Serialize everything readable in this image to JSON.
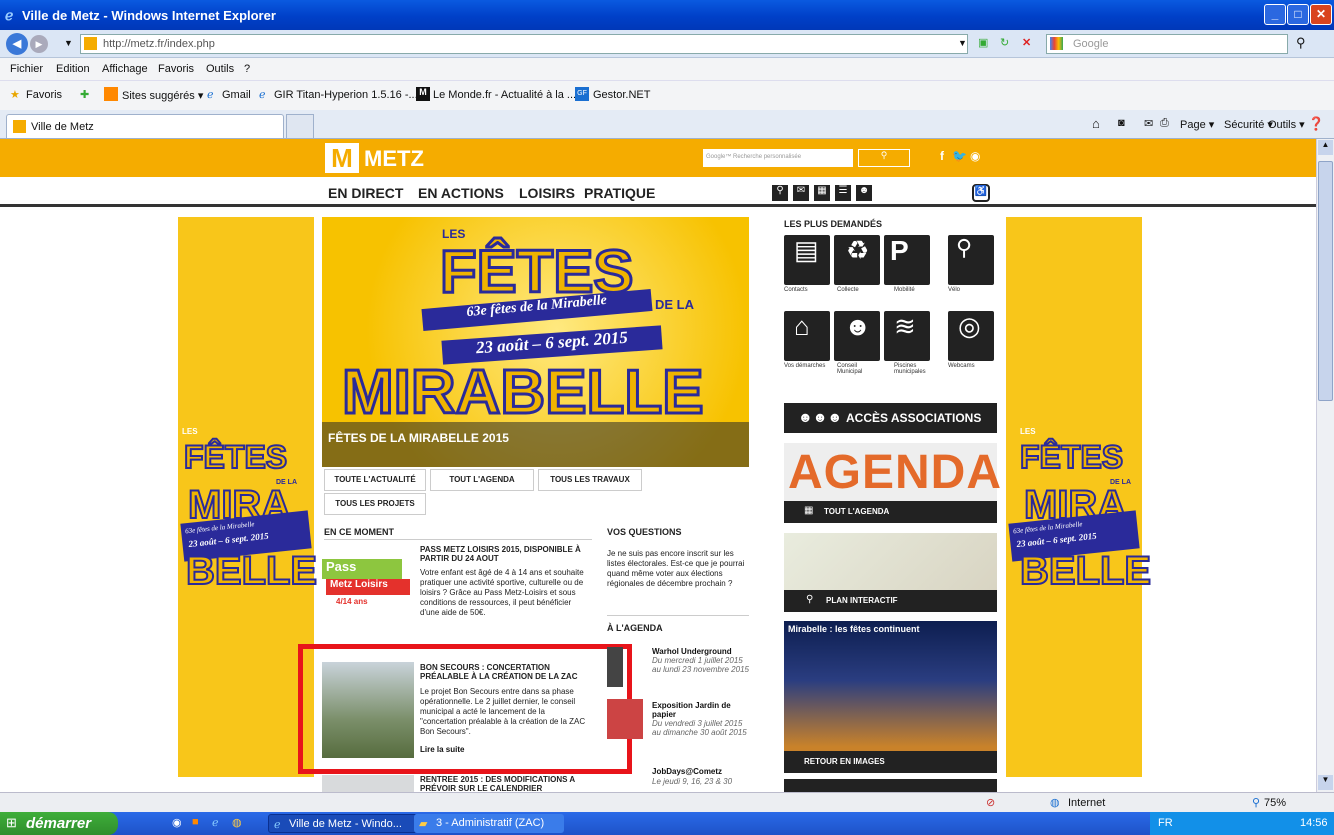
{
  "window": {
    "title": "Ville de Metz - Windows Internet Explorer"
  },
  "toolbar": {
    "url": "http://metz.fr/index.php",
    "search_placeholder": "Google"
  },
  "menu": [
    "Fichier",
    "Edition",
    "Affichage",
    "Favoris",
    "Outils",
    "?"
  ],
  "favorites": {
    "label": "Favoris",
    "items": [
      "Sites suggérés ▾",
      "Gmail",
      "GIR Titan-Hyperion 1.5.16 -...",
      "Le Monde.fr - Actualité à la ...",
      "Gestor.NET"
    ]
  },
  "tab": {
    "label": "Ville de Metz"
  },
  "cmdbar": [
    "Page ▾",
    "Sécurité ▾",
    "Outils ▾"
  ],
  "site": {
    "logo": "METZ",
    "search_placeholder": "Google™ Recherche personnalisée",
    "nav": [
      "EN DIRECT",
      "EN ACTIONS",
      "LOISIRS",
      "PRATIQUE"
    ],
    "hero": {
      "caption": "FÊTES DE LA MIRABELLE 2015",
      "big1": "FÊTES",
      "big2": "MIRABELLE",
      "les": "LES",
      "dela": "DE LA",
      "subtitle": "63e fêtes de la Mirabelle",
      "dates": "23 août – 6 sept. 2015"
    },
    "tabs": [
      "TOUTE L'ACTUALITÉ",
      "TOUT L'AGENDA",
      "TOUS LES TRAVAUX",
      "TOUS LES PROJETS"
    ],
    "en_ce_moment": "EN CE MOMENT",
    "news": [
      {
        "title": "PASS METZ LOISIRS 2015, DISPONIBLE À PARTIR DU 24 AOUT",
        "body": "Votre enfant est âgé de 4 à 14 ans et souhaite pratiquer une activité sportive, culturelle ou de loisirs ? Grâce au Pass Metz-Loisirs et sous conditions de ressources, il peut bénéficier d'une aide de 50€.",
        "img_a": "Pass",
        "img_b": "Metz Loisirs",
        "img_c": "4/14 ans"
      },
      {
        "title": "BON SECOURS : CONCERTATION PRÉALABLE À LA CRÉATION DE LA ZAC",
        "body": "Le projet Bon Secours entre dans sa phase opérationnelle. Le 2 juillet dernier, le conseil municipal a acté le lancement de la \"concertation préalable à la création de la ZAC Bon Secours\".",
        "link": "Lire la suite"
      },
      {
        "title": "RENTREE 2015 : DES MODIFICATIONS A PRÉVOIR SUR LE CALENDRIER"
      }
    ],
    "questions": {
      "title": "VOS QUESTIONS",
      "body": "Je ne suis pas encore inscrit sur les listes électorales. Est-ce que je pourrai quand même voter aux élections régionales de décembre prochain ?"
    },
    "agenda": {
      "title": "À L'AGENDA",
      "items": [
        {
          "name": "Warhol Underground",
          "date": "Du mercredi 1 juillet 2015 au lundi 23 novembre 2015"
        },
        {
          "name": "Exposition Jardin de papier",
          "date": "Du vendredi 3 juillet 2015 au dimanche 30 août 2015"
        },
        {
          "name": "JobDays@Cometz",
          "date": "Le jeudi 9, 16, 23 & 30"
        }
      ]
    },
    "plus_demandes": "LES PLUS DEMANDÉS",
    "icons": [
      "Contacts",
      "Collecte",
      "Mobilité",
      "Vélo",
      "Vos démarches",
      "Conseil Municipal",
      "Piscines municipales",
      "Webcams"
    ],
    "assoc": "ACCÈS ASSOCIATIONS",
    "agenda_banner": "AGENDA",
    "tout_agenda": "TOUT L'AGENDA",
    "plan": "PLAN INTERACTIF",
    "images_title": "Mirabelle : les fêtes continuent",
    "retour": "RETOUR EN IMAGES",
    "side": {
      "les": "LES",
      "f": "FÊTES",
      "m": "MIRA",
      "b": "BELLE",
      "dela": "DE LA",
      "sub": "63e fêtes de la Mirabelle",
      "dates": "23 août – 6 sept. 2015"
    }
  },
  "status": {
    "zone": "Internet",
    "zoom": "75%"
  },
  "taskbar": {
    "start": "démarrer",
    "tasks": [
      "Ville de Metz - Windo...",
      "3 - Administratif (ZAC)"
    ],
    "lang": "FR",
    "time": "14:56"
  },
  "colors": {
    "accent": "#f5ac00",
    "highlight": "#e8141a"
  }
}
